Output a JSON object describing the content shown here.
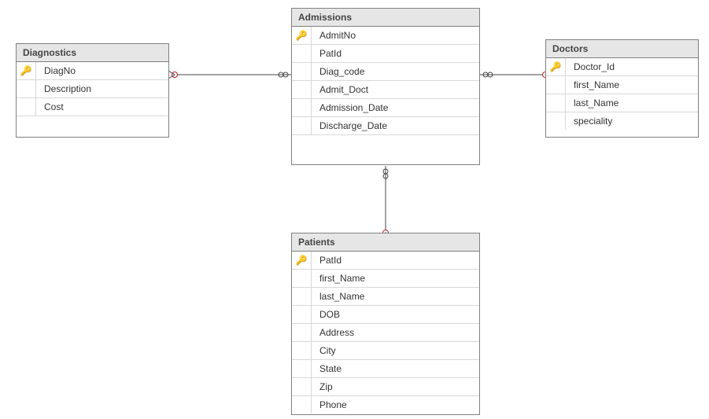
{
  "diagram": {
    "type": "erd",
    "tool_style": "sql-server-designer"
  },
  "entities": {
    "diagnostics": {
      "title": "Diagnostics",
      "columns": [
        {
          "name": "DiagNo",
          "pk": true
        },
        {
          "name": "Description",
          "pk": false
        },
        {
          "name": "Cost",
          "pk": false
        }
      ]
    },
    "admissions": {
      "title": "Admissions",
      "columns": [
        {
          "name": "AdmitNo",
          "pk": true
        },
        {
          "name": "PatId",
          "pk": false
        },
        {
          "name": "Diag_code",
          "pk": false
        },
        {
          "name": "Admit_Doct",
          "pk": false
        },
        {
          "name": "Admission_Date",
          "pk": false
        },
        {
          "name": "Discharge_Date",
          "pk": false
        }
      ]
    },
    "doctors": {
      "title": "Doctors",
      "columns": [
        {
          "name": "Doctor_Id",
          "pk": true
        },
        {
          "name": "first_Name",
          "pk": false
        },
        {
          "name": "last_Name",
          "pk": false
        },
        {
          "name": "speciality",
          "pk": false
        }
      ]
    },
    "patients": {
      "title": "Patients",
      "columns": [
        {
          "name": "PatId",
          "pk": true
        },
        {
          "name": "first_Name",
          "pk": false
        },
        {
          "name": "last_Name",
          "pk": false
        },
        {
          "name": "DOB",
          "pk": false
        },
        {
          "name": "Address",
          "pk": false
        },
        {
          "name": "City",
          "pk": false
        },
        {
          "name": "State",
          "pk": false
        },
        {
          "name": "Zip",
          "pk": false
        },
        {
          "name": "Phone",
          "pk": false
        }
      ]
    }
  },
  "relationships": [
    {
      "from": "admissions",
      "to": "diagnostics",
      "from_card": "many",
      "to_card": "one",
      "via": "Diag_code -> DiagNo"
    },
    {
      "from": "admissions",
      "to": "doctors",
      "from_card": "many",
      "to_card": "one",
      "via": "Admit_Doct -> Doctor_Id"
    },
    {
      "from": "admissions",
      "to": "patients",
      "from_card": "many",
      "to_card": "one",
      "via": "PatId -> PatId"
    }
  ]
}
